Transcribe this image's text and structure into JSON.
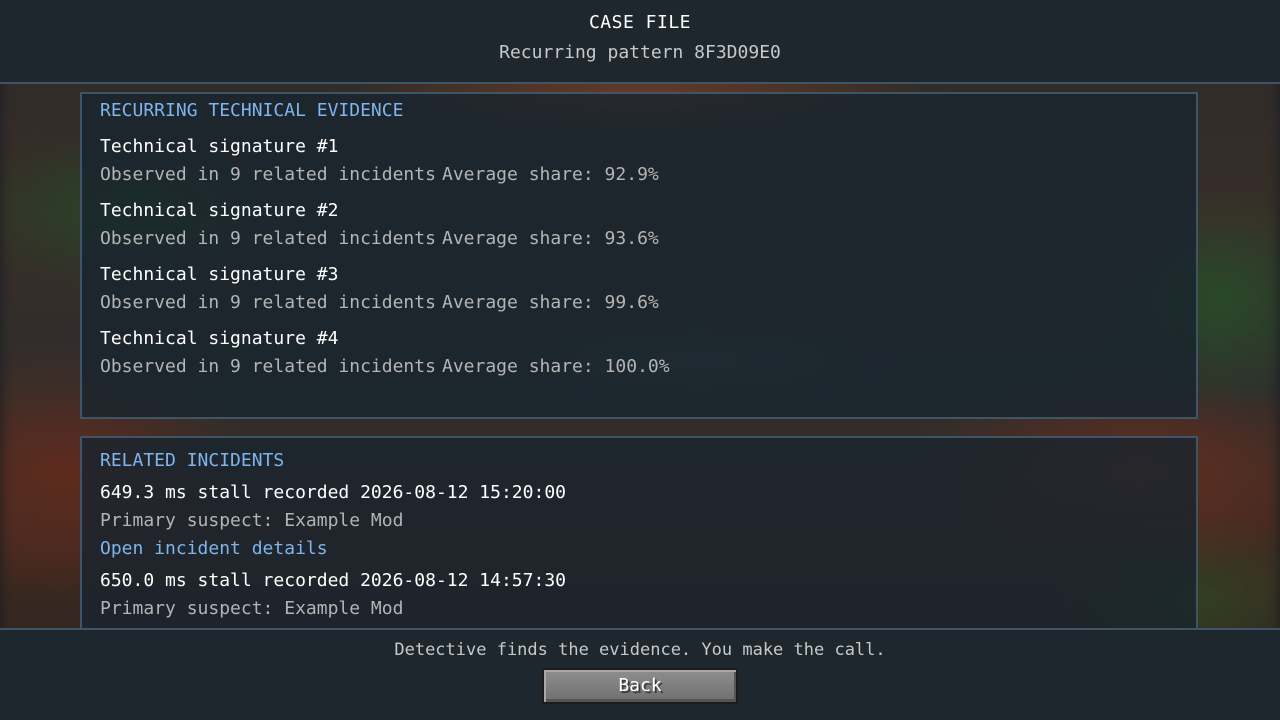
{
  "header": {
    "title": "CASE FILE",
    "subtitle": "Recurring pattern 8F3D09E0"
  },
  "evidence": {
    "heading": "RECURRING TECHNICAL EVIDENCE",
    "signatures": [
      {
        "name": "Technical signature #1",
        "observed": "Observed in 9 related incidents",
        "share": "Average share: 92.9%"
      },
      {
        "name": "Technical signature #2",
        "observed": "Observed in 9 related incidents",
        "share": "Average share: 93.6%"
      },
      {
        "name": "Technical signature #3",
        "observed": "Observed in 9 related incidents",
        "share": "Average share: 99.6%"
      },
      {
        "name": "Technical signature #4",
        "observed": "Observed in 9 related incidents",
        "share": "Average share: 100.0%"
      }
    ]
  },
  "incidents": {
    "heading": "RELATED INCIDENTS",
    "items": [
      {
        "title": "649.3 ms stall recorded 2026-08-12 15:20:00",
        "suspect": "Primary suspect: Example Mod",
        "link": "Open incident details"
      },
      {
        "title": "650.0 ms stall recorded 2026-08-12 14:57:30",
        "suspect": "Primary suspect: Example Mod"
      }
    ]
  },
  "footer": {
    "tagline": "Detective finds the evidence. You make the call.",
    "back_label": "Back"
  }
}
